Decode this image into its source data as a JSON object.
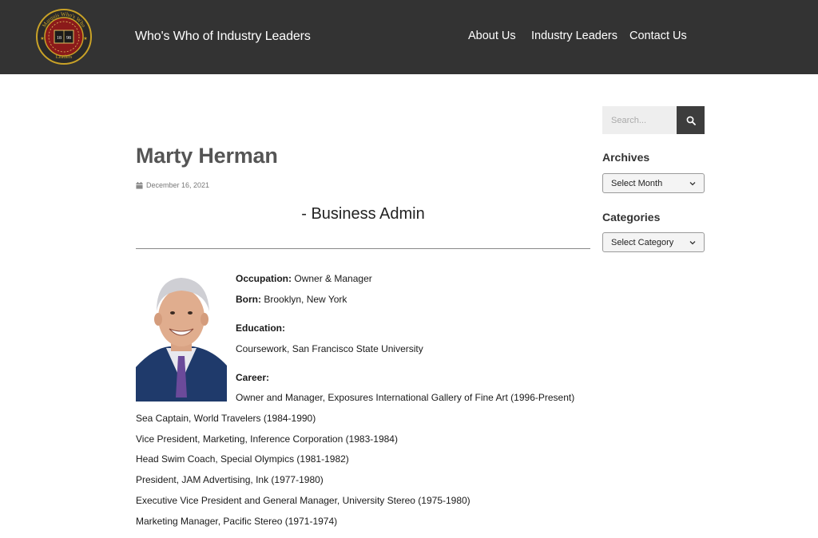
{
  "header": {
    "logo": {
      "ring_text": "Marquis Who's Who",
      "year_left": "18",
      "year_right": "98",
      "bottom_text": "Leaders"
    },
    "site_title": "Who's Who of Industry Leaders",
    "nav": [
      {
        "label": "About Us",
        "name": "nav-about-us"
      },
      {
        "label": "Industry Leaders",
        "name": "nav-industry-leaders"
      },
      {
        "label": "Contact Us",
        "name": "nav-contact-us"
      }
    ]
  },
  "post": {
    "title": "Marty Herman",
    "date": "December 16, 2021",
    "subtitle": "- Business Admin",
    "occupation_label": "Occupation:",
    "occupation_value": "Owner & Manager",
    "born_label": "Born:",
    "born_value": "Brooklyn, New York",
    "education_label": "Education:",
    "education_items": [
      "Coursework, San Francisco State University"
    ],
    "career_label": "Career:",
    "career_items": [
      "Owner and Manager, Exposures International Gallery of Fine Art (1996-Present)",
      "Sea Captain, World Travelers (1984-1990)",
      "Vice President, Marketing, Inference Corporation (1983-1984)",
      "Head Swim Coach, Special Olympics (1981-1982)",
      "President, JAM Advertising, Ink (1977-1980)",
      "Executive Vice President and General Manager, University Stereo (1975-1980)",
      "Marketing Manager, Pacific Stereo (1971-1974)"
    ]
  },
  "sidebar": {
    "search": {
      "placeholder": "Search..."
    },
    "archives": {
      "title": "Archives",
      "selected": "Select Month"
    },
    "categories": {
      "title": "Categories",
      "selected": "Select Category"
    }
  },
  "colors": {
    "header_bg": "#333333",
    "logo_gold": "#c9a227",
    "logo_red": "#8b1a1a"
  },
  "icons": {
    "date": "calendar-icon",
    "search": "search-icon",
    "select": "chevron-down-icon"
  }
}
